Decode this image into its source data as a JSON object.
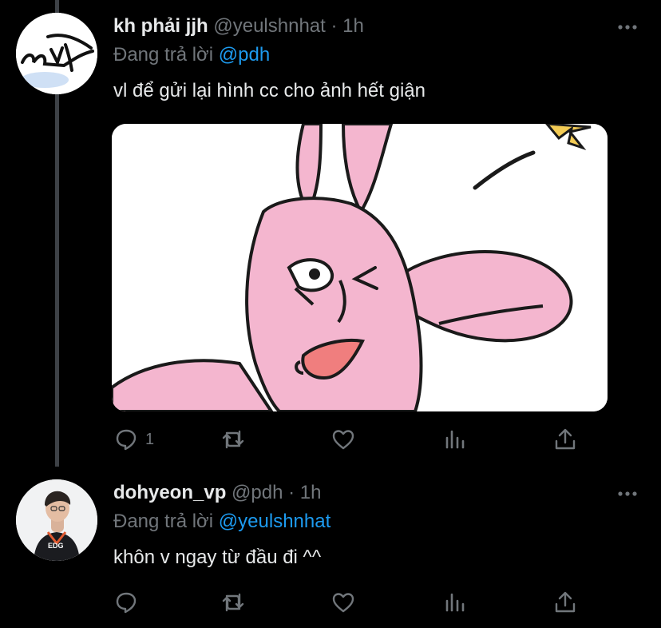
{
  "tweets": [
    {
      "display_name": "kh phải jjh",
      "handle": "@yeulshnhat",
      "separator": "·",
      "time": "1h",
      "reply_prefix": "Đang trả lời",
      "reply_to": "@pdh",
      "text": "vl để gửi lại hình cc cho ảnh hết giận",
      "has_media": true,
      "reply_count": "1"
    },
    {
      "display_name": "dohyeon_vp",
      "handle": "@pdh",
      "separator": "·",
      "time": "1h",
      "reply_prefix": "Đang trả lời",
      "reply_to": "@yeulshnhat",
      "text": "khôn v ngay từ đầu đi ^^",
      "avatar_jersey_text": "EDG",
      "reply_count": ""
    }
  ],
  "icons": [
    "reply-icon",
    "retweet-icon",
    "like-icon",
    "analytics-icon",
    "share-icon",
    "more-icon"
  ],
  "colors": {
    "background": "#000000",
    "accent": "#1d9bf0",
    "secondary_text": "#71767b",
    "primary_text": "#e7e9ea",
    "bunny_pink": "#f4b6cf"
  }
}
